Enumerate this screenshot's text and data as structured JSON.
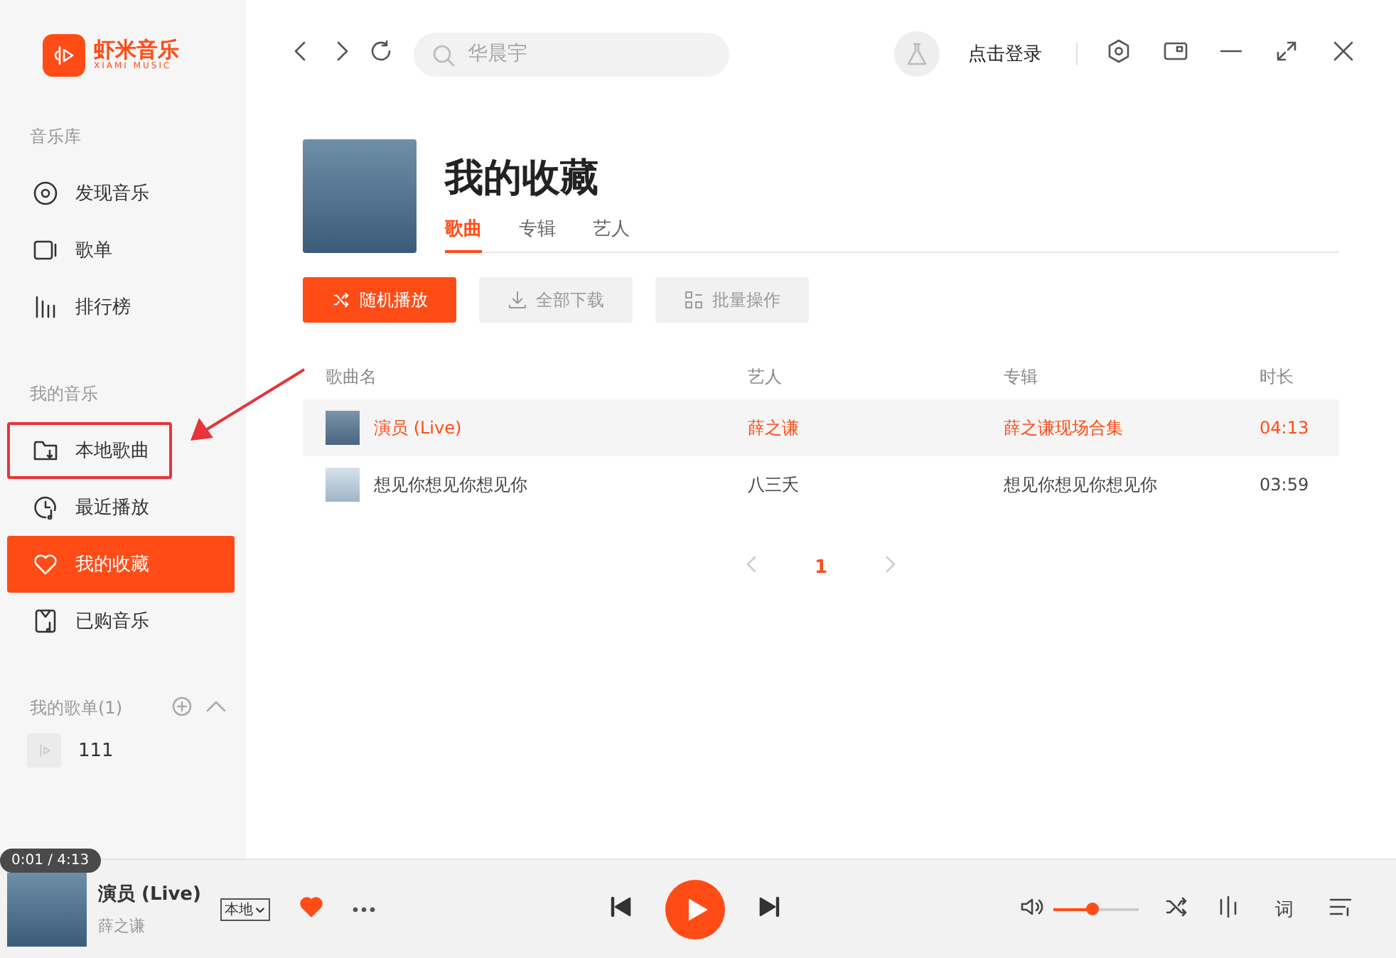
{
  "logo": {
    "name": "虾米音乐",
    "subtitle": "XIAMI MUSIC"
  },
  "sidebar": {
    "sections": [
      {
        "title": "音乐库",
        "items": [
          {
            "label": "发现音乐",
            "selected": false,
            "annotated": false
          },
          {
            "label": "歌单",
            "selected": false,
            "annotated": false
          },
          {
            "label": "排行榜",
            "selected": false,
            "annotated": false
          }
        ]
      },
      {
        "title": "我的音乐",
        "items": [
          {
            "label": "本地歌曲",
            "selected": false,
            "annotated": true
          },
          {
            "label": "最近播放",
            "selected": false,
            "annotated": false
          },
          {
            "label": "我的收藏",
            "selected": true,
            "annotated": false
          },
          {
            "label": "已购音乐",
            "selected": false,
            "annotated": false
          }
        ]
      }
    ],
    "playlists_title": "我的歌单(1)",
    "playlists": [
      {
        "name": "111"
      }
    ]
  },
  "toolbar": {
    "search": {
      "placeholder": "华晨宇"
    },
    "login": "点击登录"
  },
  "page": {
    "title": "我的收藏",
    "tabs": [
      {
        "label": "歌曲",
        "selected": true
      },
      {
        "label": "专辑",
        "selected": false
      },
      {
        "label": "艺人",
        "selected": false
      }
    ],
    "actions": [
      {
        "label": "随机播放",
        "kind": "primary"
      },
      {
        "label": "全部下载",
        "kind": "secondary"
      },
      {
        "label": "批量操作",
        "kind": "secondary"
      }
    ]
  },
  "table": {
    "columns": [
      "歌曲名",
      "艺人",
      "专辑",
      "时长"
    ],
    "rows": [
      {
        "title": "演员 (Live)",
        "artist": "薛之谦",
        "album": "薛之谦现场合集",
        "duration": "04:13",
        "selected": true
      },
      {
        "title": "想见你想见你想见你",
        "artist": "八三夭",
        "album": "想见你想见你想见你",
        "duration": "03:59",
        "selected": false
      }
    ]
  },
  "pagination": {
    "pages": [
      {
        "label": "1",
        "selected": true
      }
    ]
  },
  "player": {
    "time": "0:01 / 4:13",
    "level": 0.004,
    "title": "演员 (Live)",
    "artist": "薛之谦",
    "source": "本地",
    "liked": true,
    "volume": {
      "level": 0.45
    },
    "lyrics": "词"
  }
}
